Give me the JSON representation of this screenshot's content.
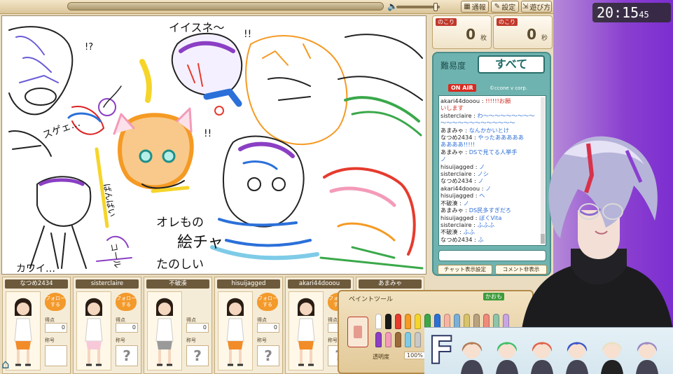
{
  "topbar": {
    "progress": 1.0,
    "volume": 0.95,
    "buttons": [
      {
        "icon": "grid-icon",
        "label": "通報"
      },
      {
        "icon": "wrench-icon",
        "label": "設定"
      },
      {
        "icon": "exit-icon",
        "label": "遊び方"
      }
    ]
  },
  "canvas": {
    "texts": [
      {
        "text": "イイスネ〜",
        "color": "#111111"
      },
      {
        "text": "!!",
        "color": "#111111"
      },
      {
        "text": "!?",
        "color": "#111111"
      },
      {
        "text": "オレもの",
        "color": "#111111"
      },
      {
        "text": "絵チャ",
        "color": "#111111"
      },
      {
        "text": "たのしい",
        "color": "#111111"
      },
      {
        "text": "カワイ…",
        "color": "#111111"
      },
      {
        "text": "コール",
        "color": "#111111"
      },
      {
        "text": "ばんばい",
        "color": "#111111"
      },
      {
        "text": "スゲェ…",
        "color": "#111111"
      },
      {
        "text": "!!",
        "color": "#111111"
      }
    ]
  },
  "players": [
    {
      "name": "なつめ2434",
      "follow": "フォローする",
      "points_label": "得点",
      "points": "0",
      "title_label": "称号",
      "title": "",
      "outfit": "#f28c28",
      "follow_visible": true
    },
    {
      "name": "sisterclaire",
      "follow": "フォローする",
      "points_label": "得点",
      "points": "0",
      "title_label": "称号",
      "title": "?",
      "outfit": "#f7c9d8",
      "follow_visible": true
    },
    {
      "name": "不破湊",
      "follow": "",
      "points_label": "得点",
      "points": "0",
      "title_label": "称号",
      "title": "?",
      "outfit": "#9a9a9a",
      "follow_visible": false
    },
    {
      "name": "hisuijagged",
      "follow": "フォローする",
      "points_label": "得点",
      "points": "0",
      "title_label": "称号",
      "title": "?",
      "outfit": "#f28c28",
      "follow_visible": true
    },
    {
      "name": "akari44dooou",
      "follow": "フォローする",
      "points_label": "得点",
      "points": "0",
      "title_label": "称号",
      "title": "?",
      "outfit": "#f28c28",
      "follow_visible": true
    },
    {
      "name": "あまみゃ",
      "follow": "",
      "points_label": "",
      "points": "",
      "title_label": "",
      "title": "",
      "outfit": "#f28c28",
      "follow_visible": false
    }
  ],
  "counters": {
    "remaining_label": "のこり",
    "remaining_value": "0",
    "remaining_unit": "枚",
    "time_label": "のこり",
    "time_value": "0",
    "time_unit": "秒"
  },
  "chat": {
    "difficulty_label": "難易度",
    "difficulty_value": "すべて",
    "onair": "ON AIR",
    "copyright": "©ccone v corp.",
    "lines": [
      {
        "user": "akari44dooou",
        "msg": "!!!!!!お願",
        "red": true
      },
      {
        "user": "",
        "msg": "いします",
        "red": true
      },
      {
        "user": "sisterclaire",
        "msg": "わ〜〜〜〜〜〜〜〜〜",
        "red": false
      },
      {
        "user": "",
        "msg": "〜〜〜〜〜〜〜〜〜〜〜〜〜",
        "red": false
      },
      {
        "user": "あまみゃ",
        "msg": "なんかかいとけ",
        "red": false
      },
      {
        "user": "なつめ2434",
        "msg": "やったあああああ",
        "red": false
      },
      {
        "user": "",
        "msg": "ああああ!!!!!",
        "red": false
      },
      {
        "user": "あまみゃ",
        "msg": "DSで見てる人挙手",
        "red": false
      },
      {
        "user": "",
        "msg": "ノ",
        "red": false
      },
      {
        "user": "hisuijagged",
        "msg": "ノ",
        "red": false
      },
      {
        "user": "sisterclaire",
        "msg": "ノシ",
        "red": false
      },
      {
        "user": "なつめ2434",
        "msg": "ノ",
        "red": false
      },
      {
        "user": "akari44dooou",
        "msg": "ノ",
        "red": false
      },
      {
        "user": "hisuijagged",
        "msg": "ヘ",
        "red": false
      },
      {
        "user": "不破湊",
        "msg": "ノ",
        "red": false
      },
      {
        "user": "あまみゃ",
        "msg": "DS民多すぎだろ",
        "red": false
      },
      {
        "user": "hisuijagged",
        "msg": "ぼくVita",
        "red": false
      },
      {
        "user": "sisterclaire",
        "msg": "ふふふ",
        "red": false
      },
      {
        "user": "不破湊",
        "msg": "ふふ",
        "red": false
      },
      {
        "user": "なつめ2434",
        "msg": "ふ",
        "red": false
      }
    ],
    "settings_button": "チャット表示設定",
    "hide_button": "コメント非表示"
  },
  "paint": {
    "title": "ペイントツール",
    "close_label": "かおも",
    "opacity_label": "透明度",
    "opacity_value": "100%",
    "colors": [
      "#ffffff",
      "#1a1a1a",
      "#e63b2e",
      "#f59a23",
      "#f6d52a",
      "#3aa84a",
      "#2b70d9",
      "#8b3fc4",
      "#f39bb8",
      "#9c6a3a",
      "#7ecbe8",
      "#c9c9c9",
      "#5a3d1f",
      "#d86a8c"
    ]
  },
  "stream": {
    "clock_hm": "20:15",
    "clock_s": "45",
    "team_letter": "F",
    "accent": "#8a3fd0"
  }
}
